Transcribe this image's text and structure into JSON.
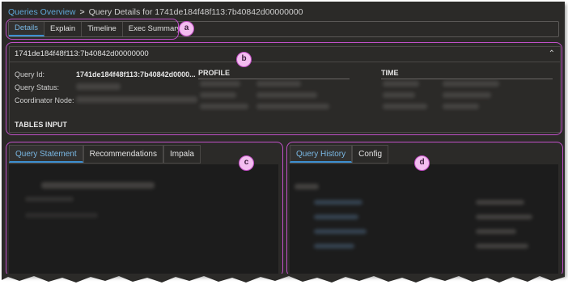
{
  "breadcrumb": {
    "link": "Queries Overview",
    "separator": ">",
    "current": "Query Details for 1741de184f48f113:7b40842d00000000"
  },
  "top_tabs": [
    "Details",
    "Explain",
    "Timeline",
    "Exec Summary"
  ],
  "callouts": {
    "a": "a",
    "b": "b",
    "c": "c",
    "d": "d"
  },
  "details": {
    "header_id": "1741de184f48f113:7b40842d00000000",
    "collapse_icon": "chevron-up",
    "query_id_label": "Query Id:",
    "query_id_value": "1741de184f48f113:7b40842d0000...",
    "query_status_label": "Query Status:",
    "coordinator_label": "Coordinator Node:",
    "profile_heading": "PROFILE",
    "time_heading": "TIME",
    "tables_input_heading": "TABLES INPUT"
  },
  "left_panel": {
    "tabs": [
      "Query Statement",
      "Recommendations",
      "Impala"
    ]
  },
  "right_panel": {
    "tabs": [
      "Query History",
      "Config"
    ]
  },
  "colors": {
    "accent": "#3d8fd0",
    "link": "#5fa8d8",
    "callout_border": "#c050c8",
    "callout_fill": "#f3bdf0",
    "background": "#2b2a28"
  }
}
